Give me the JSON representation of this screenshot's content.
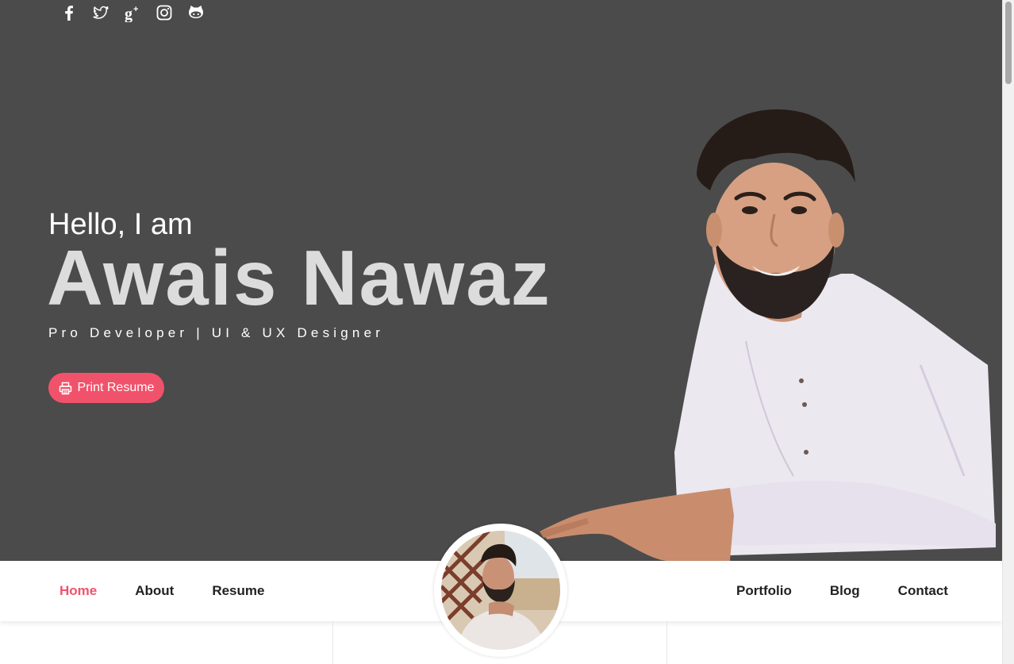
{
  "social": [
    {
      "name": "facebook-icon"
    },
    {
      "name": "twitter-icon"
    },
    {
      "name": "google-plus-icon"
    },
    {
      "name": "instagram-icon"
    },
    {
      "name": "github-icon"
    }
  ],
  "hero": {
    "greeting": "Hello, I am",
    "name": "Awais Nawaz",
    "tagline": "Pro Developer | UI & UX Designer",
    "print_button": "Print Resume"
  },
  "nav": {
    "left": [
      "Home",
      "About",
      "Resume"
    ],
    "right": [
      "Portfolio",
      "Blog",
      "Contact"
    ],
    "active": "Home"
  },
  "colors": {
    "accent": "#f1526b",
    "hero_background": "#4b4b4b",
    "name_text": "#dcdcdc",
    "nav_text": "#222222"
  }
}
